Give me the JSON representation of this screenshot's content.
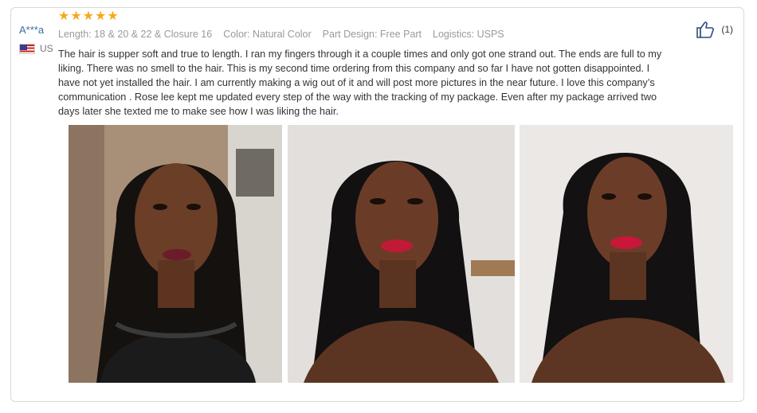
{
  "review": {
    "user_name": "A***a",
    "country": "US",
    "rating": 5,
    "attributes": [
      "Length: 18 & 20 & 22 & Closure 16",
      "Color: Natural Color",
      "Part Design: Free Part",
      "Logistics: USPS"
    ],
    "text": "The hair is supper soft and true to length. I ran my fingers through it a couple times and only got one strand out. The ends are full to my liking. There was no smell to the hair. This is my second time ordering from this company and so far I have not gotten disappointed. I have not yet installed the hair. I am currently making a wig out of it and will post more pictures in the near future. I love this company’s communication . Rose lee kept me updated every step of the way with the tracking of my package. Even after my package arrived two days later she texted me to make see how I was liking the hair.",
    "helpful_count": "(1)",
    "photos": [
      {
        "icon": "review-photo-1"
      },
      {
        "icon": "review-photo-2"
      },
      {
        "icon": "review-photo-3"
      }
    ]
  },
  "colors": {
    "star": "#f7a81b",
    "username": "#3a6ea5",
    "border": "#d9d9d9"
  }
}
